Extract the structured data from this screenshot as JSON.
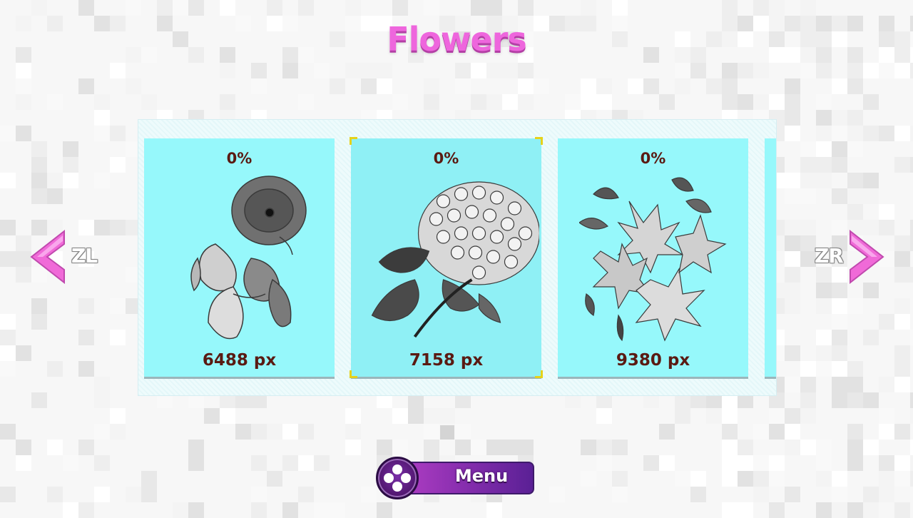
{
  "screen": {
    "title": "Flowers",
    "title_color": "#ee66dd"
  },
  "cards": [
    {
      "progress": "0%",
      "size": "6488 px",
      "image": "morning-glory-flower-icon",
      "selected": false
    },
    {
      "progress": "0%",
      "size": "7158 px",
      "image": "hydrangea-flower-icon",
      "selected": true
    },
    {
      "progress": "0%",
      "size": "9380 px",
      "image": "azalea-flower-icon",
      "selected": false
    }
  ],
  "nav": {
    "left_key": "ZL",
    "right_key": "ZR",
    "arrow_color": "#f06ad8"
  },
  "menu": {
    "label": "Menu",
    "icon": "controller-buttons-icon"
  },
  "colors": {
    "card_bg": "#96f8fb",
    "text": "#5a1a12",
    "selection_corner": "#e6d21a"
  }
}
